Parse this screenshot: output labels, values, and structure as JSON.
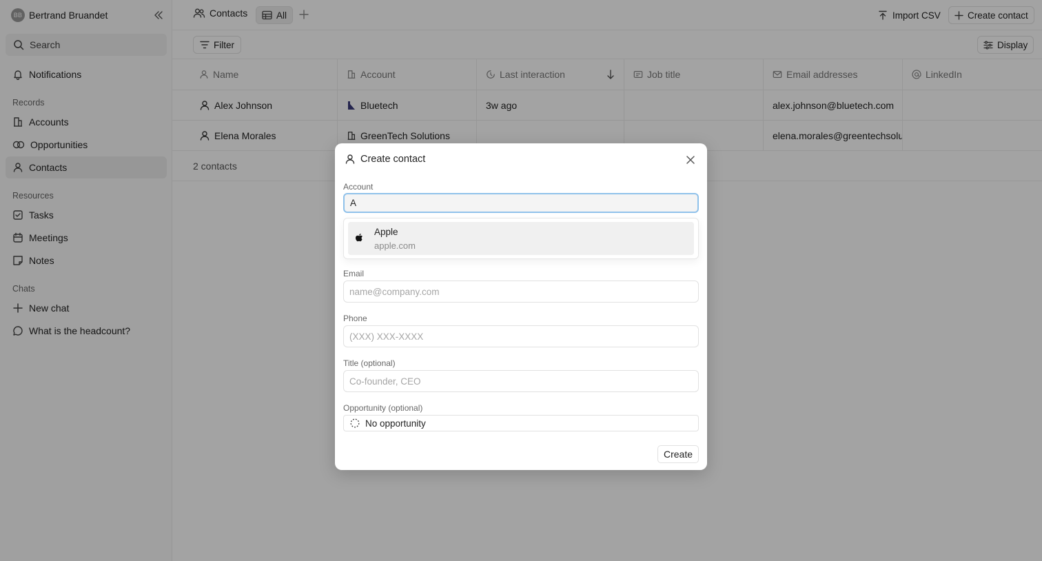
{
  "sidebar": {
    "user": {
      "initials": "BB",
      "name": "Bertrand Bruandet"
    },
    "search_label": "Search",
    "notifications_label": "Notifications",
    "records_label": "Records",
    "records": [
      {
        "label": "Accounts",
        "icon": "building-icon"
      },
      {
        "label": "Opportunities",
        "icon": "rings-icon"
      },
      {
        "label": "Contacts",
        "icon": "person-icon"
      }
    ],
    "resources_label": "Resources",
    "resources": [
      {
        "label": "Tasks",
        "icon": "checkbox-icon"
      },
      {
        "label": "Meetings",
        "icon": "calendar-icon"
      },
      {
        "label": "Notes",
        "icon": "note-icon"
      }
    ],
    "chats_label": "Chats",
    "chats": [
      {
        "label": "New chat",
        "icon": "plus-icon"
      },
      {
        "label": "What is the headcount?",
        "icon": "chat-bubble-icon"
      }
    ]
  },
  "topbar": {
    "object_tab": "Contacts",
    "view_tab": "All",
    "import_label": "Import CSV",
    "create_label": "Create contact"
  },
  "toolbar": {
    "filter_label": "Filter",
    "display_label": "Display"
  },
  "table": {
    "columns": [
      "Name",
      "Account",
      "Last interaction",
      "Job title",
      "Email addresses",
      "LinkedIn"
    ],
    "rows": [
      {
        "name": "Alex Johnson",
        "account": "Bluetech",
        "last_interaction": "3w ago",
        "job_title": "",
        "email": "alex.johnson@bluetech.com",
        "linkedin": ""
      },
      {
        "name": "Elena Morales",
        "account": "GreenTech Solutions",
        "last_interaction": "",
        "job_title": "",
        "email": "elena.morales@greentechsolutions.com",
        "linkedin": ""
      }
    ],
    "footer": "2 contacts"
  },
  "modal": {
    "title": "Create contact",
    "account_label": "Account",
    "account_value": "A",
    "suggestion": {
      "name": "Apple",
      "domain": "apple.com"
    },
    "email_label": "Email",
    "email_placeholder": "name@company.com",
    "phone_label": "Phone",
    "phone_placeholder": "(XXX) XXX-XXXX",
    "title_label": "Title (optional)",
    "title_placeholder": "Co-founder, CEO",
    "opportunity_label": "Opportunity (optional)",
    "opportunity_value": "No opportunity",
    "submit_label": "Create"
  },
  "colors": {
    "focus_ring": "#8fc1ea",
    "overlay": "rgba(0,0,0,0.36)"
  }
}
